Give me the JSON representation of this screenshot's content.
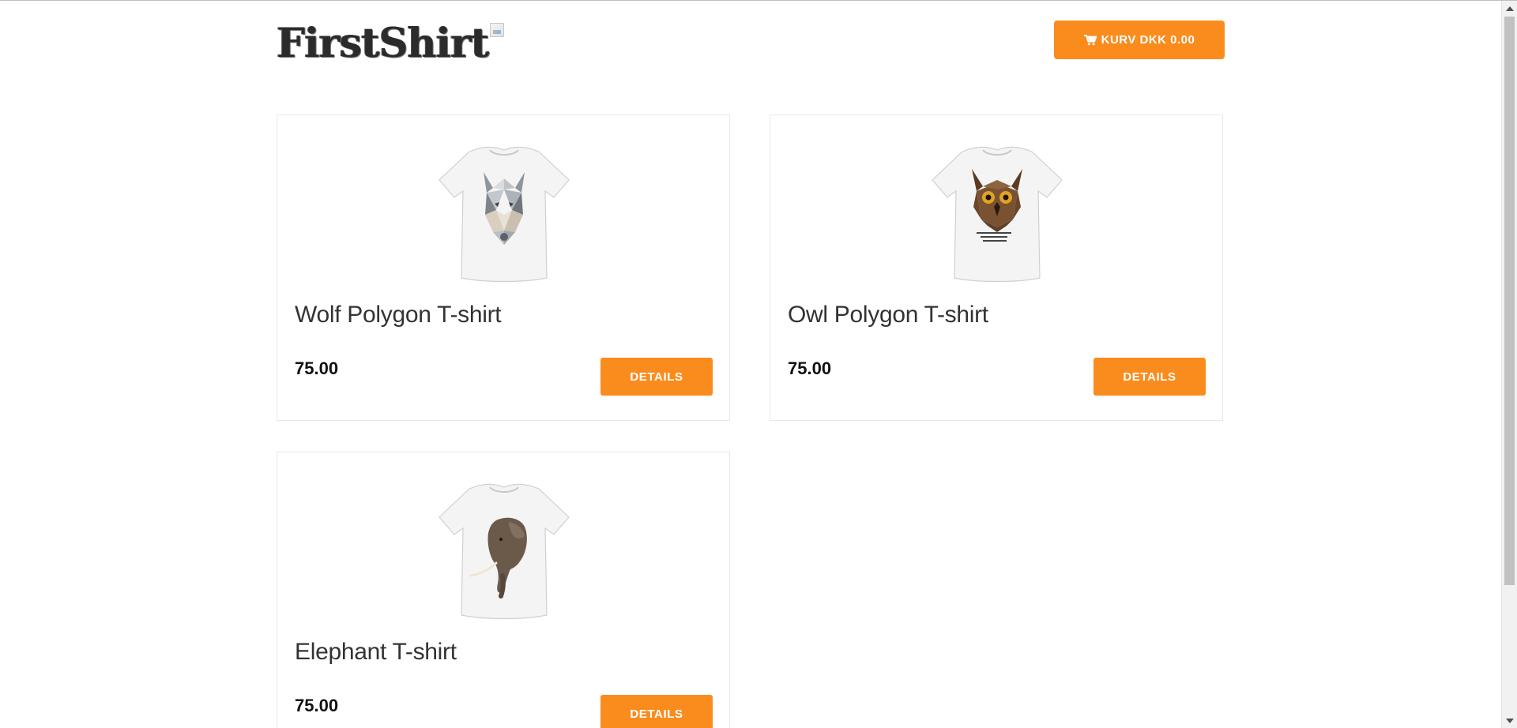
{
  "header": {
    "logo_text": "FirstShirt",
    "cart_label": "KURV DKK 0.00",
    "cart_icon": "shopping-cart-icon"
  },
  "products": [
    {
      "title": "Wolf Polygon T-shirt",
      "price": "75.00",
      "details_label": "DETAILS"
    },
    {
      "title": "Owl Polygon T-shirt",
      "price": "75.00",
      "details_label": "DETAILS"
    },
    {
      "title": "Elephant T-shirt",
      "price": "75.00",
      "details_label": "DETAILS"
    }
  ],
  "colors": {
    "accent": "#fa8c1e",
    "card_border": "#e8e8e8",
    "background": "#ffffff"
  }
}
